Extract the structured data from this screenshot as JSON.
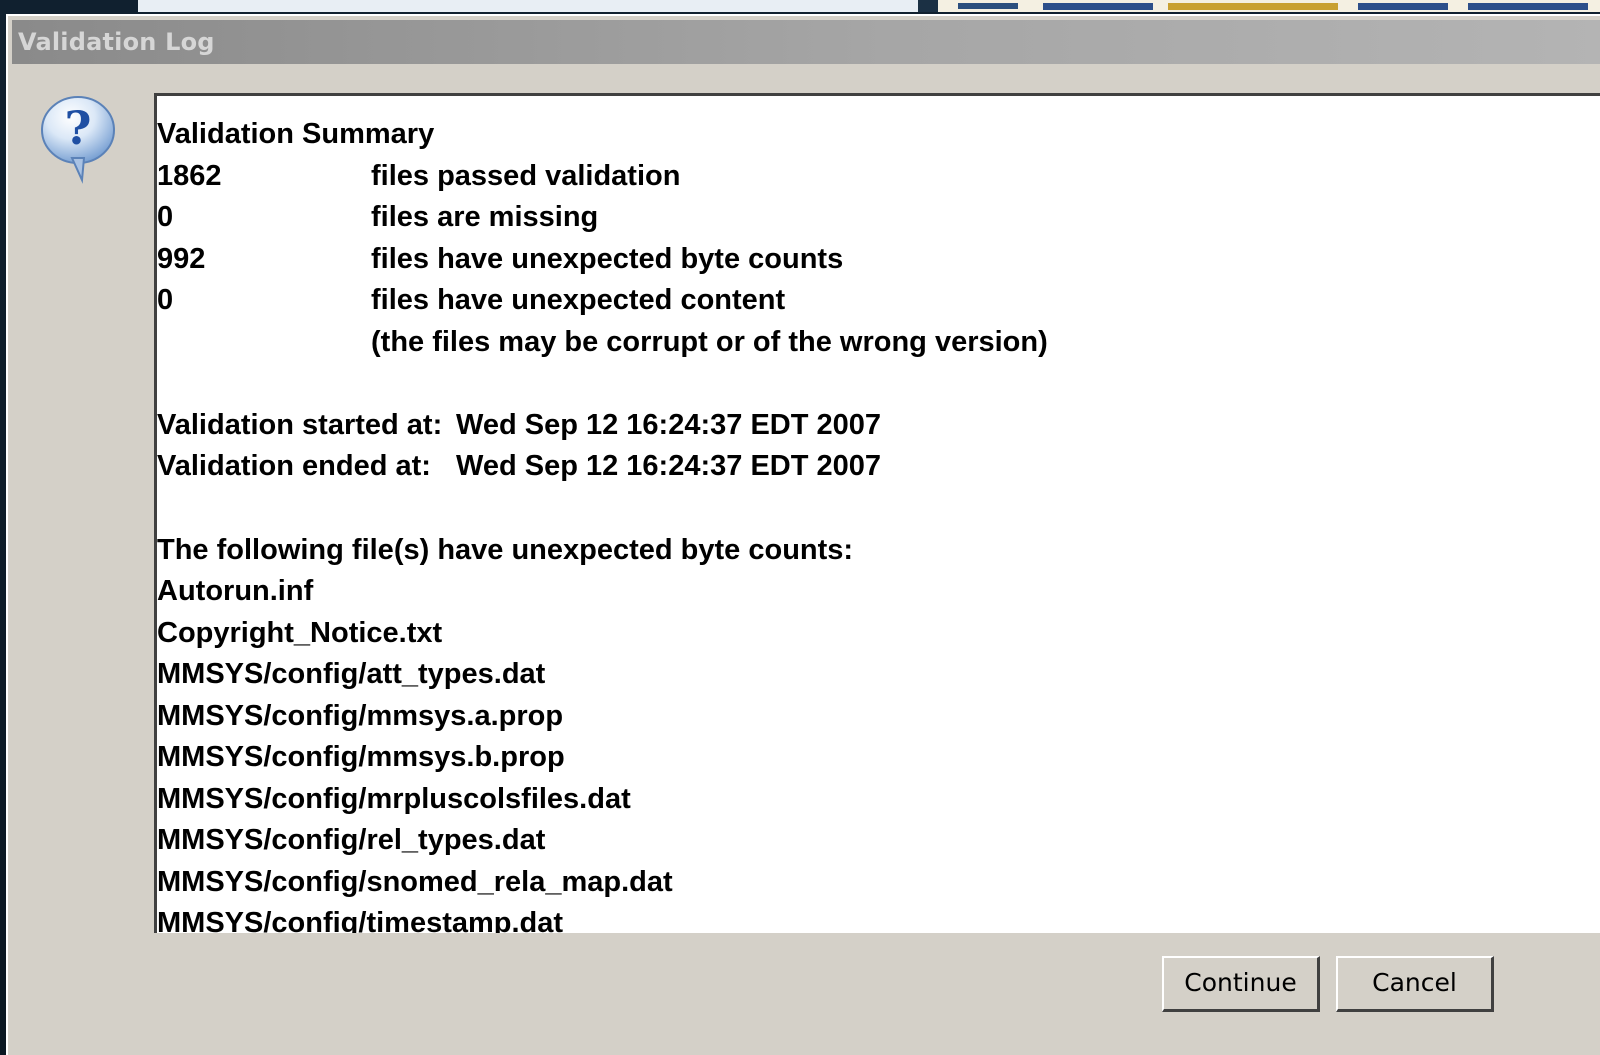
{
  "window": {
    "title": "Validation Log"
  },
  "icon": {
    "name": "question-icon",
    "glyph": "?"
  },
  "summary": {
    "heading": "Validation Summary",
    "rows": [
      {
        "count": "1862",
        "label": "files passed validation"
      },
      {
        "count": "0",
        "label": "files are missing"
      },
      {
        "count": "992",
        "label": "files have unexpected byte counts"
      },
      {
        "count": "0",
        "label": "files have unexpected content"
      },
      {
        "count": "",
        "label": "(the files may be corrupt or of the wrong version)"
      }
    ],
    "started_label": "Validation started at:",
    "started_value": "Wed Sep 12 16:24:37 EDT 2007",
    "ended_label": "Validation ended at:",
    "ended_value": "Wed Sep 12 16:24:37 EDT 2007"
  },
  "unexpected": {
    "heading": "The following file(s) have unexpected byte counts:",
    "files": [
      "Autorun.inf",
      "Copyright_Notice.txt",
      "MMSYS/config/att_types.dat",
      "MMSYS/config/mmsys.a.prop",
      "MMSYS/config/mmsys.b.prop",
      "MMSYS/config/mrpluscolsfiles.dat",
      "MMSYS/config/rel_types.dat",
      "MMSYS/config/snomed_rela_map.dat",
      "MMSYS/config/timestamp.dat"
    ]
  },
  "buttons": {
    "continue": "Continue",
    "cancel": "Cancel"
  },
  "colors": {
    "dialog_bg": "#d4d0c8",
    "titlebar": "#9a9a9a",
    "icon_blue": "#2a5fb0"
  }
}
